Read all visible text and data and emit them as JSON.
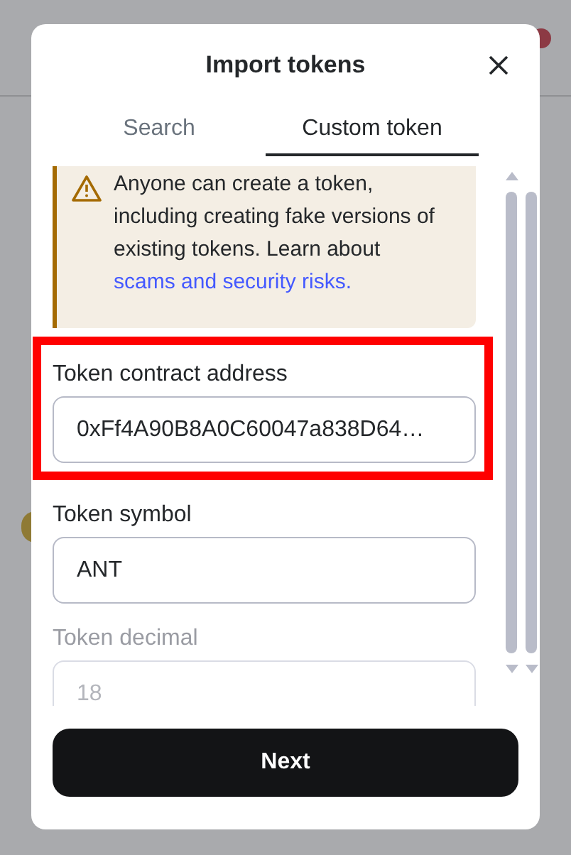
{
  "dialog": {
    "title": "Import tokens"
  },
  "tabs": [
    {
      "label": "Search",
      "selected": false
    },
    {
      "label": "Custom token",
      "selected": true
    }
  ],
  "warning": {
    "text": "Anyone can create a token, including creating fake versions of existing tokens. Learn about ",
    "link": "scams and security risks."
  },
  "fields": [
    {
      "label": "Token contract address",
      "value": "0xFf4A90B8A0C60047a838D64…",
      "disabled": false,
      "highlighted": true
    },
    {
      "label": "Token symbol",
      "value": "ANT",
      "disabled": false,
      "highlighted": false
    },
    {
      "label": "Token decimal",
      "value": "18",
      "disabled": true,
      "highlighted": false
    }
  ],
  "next_button": "Next"
}
